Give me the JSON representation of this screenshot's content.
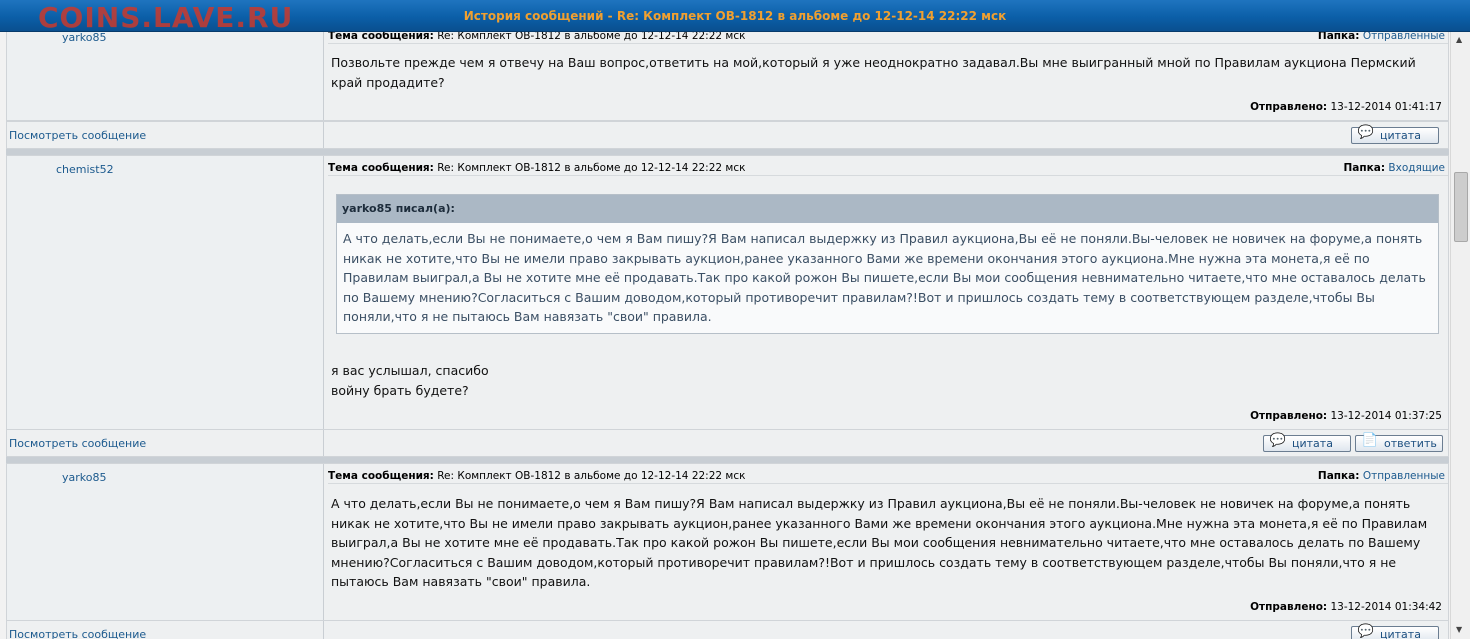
{
  "header": {
    "logo_text": "COINS.LAVE.RU",
    "title": "История сообщений - Re: Комплект ОВ-1812 в альбоме до 12-12-14 22:22 мск"
  },
  "labels": {
    "subject_label": "Тема сообщения:",
    "folder_label": "Папка:",
    "sent_label": "Отправлено:",
    "view_message": "Посмотреть сообщение",
    "quote_button": "цитата",
    "reply_button": "ответить"
  },
  "messages": [
    {
      "author": "yarko85",
      "subject": "Re: Комплект ОВ-1812 в альбоме до 12-12-14 22:22 мск",
      "folder": "Отправленные",
      "text": "Позвольте прежде чем я отвечу на Ваш вопрос,ответить на мой,который я уже неоднократно задавал.Вы мне выигранный мной по Правилам аукциона Пермский край продадите?",
      "sent": "13-12-2014 01:41:17"
    },
    {
      "author": "chemist52",
      "subject": "Re: Комплект ОВ-1812 в альбоме до 12-12-14 22:22 мск",
      "folder": "Входящие",
      "quote_author": "yarko85 писал(а):",
      "quote_text": "А что делать,если Вы не понимаете,о чем я Вам пишу?Я Вам написал выдержку из Правил аукциона,Вы её не поняли.Вы-человек не новичек на форуме,а понять никак не хотите,что Вы не имели право закрывать аукцион,ранее указанного Вами же времени окончания этого аукциона.Мне нужна эта монета,я её по Правилам выиграл,а Вы не хотите мне её продавать.Так про какой рожон Вы пишете,если Вы мои сообщения невнимательно читаете,что мне оставалось делать по Вашему мнению?Согласиться с Вашим доводом,который противоречит правилам?!Вот и пришлось создать тему в соответствующем разделе,чтобы Вы поняли,что я не пытаюсь Вам навязать \"свои\" правила.",
      "text_line1": "я вас услышал, спасибо",
      "text_line2": "войну брать будете?",
      "sent": "13-12-2014 01:37:25"
    },
    {
      "author": "yarko85",
      "subject": "Re: Комплект ОВ-1812 в альбоме до 12-12-14 22:22 мск",
      "folder": "Отправленные",
      "text": "А что делать,если Вы не понимаете,о чем я Вам пишу?Я Вам написал выдержку из Правил аукциона,Вы её не поняли.Вы-человек не новичек на форуме,а понять никак не хотите,что Вы не имели право закрывать аукцион,ранее указанного Вами же времени окончания этого аукциона.Мне нужна эта монета,я её по Правилам выиграл,а Вы не хотите мне её продавать.Так про какой рожон Вы пишете,если Вы мои сообщения невнимательно читаете,что мне оставалось делать по Вашему мнению?Согласиться с Вашим доводом,который противоречит правилам?!Вот и пришлось создать тему в соответствующем разделе,чтобы Вы поняли,что я не пытаюсь Вам навязать \"свои\" правила.",
      "sent": "13-12-2014 01:34:42"
    }
  ],
  "icons": {
    "quote_icon": "speech-bubble-icon",
    "reply_icon": "document-icon"
  }
}
